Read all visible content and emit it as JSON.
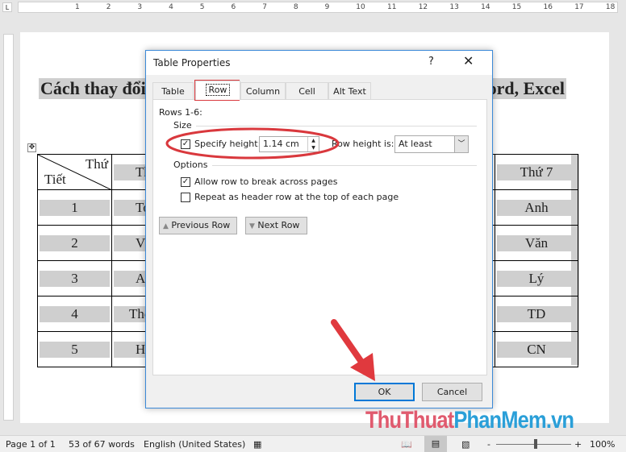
{
  "ruler": {
    "corner": "L",
    "ticks": [
      "1",
      "2",
      "3",
      "4",
      "5",
      "6",
      "7",
      "8",
      "9",
      "10",
      "11",
      "12",
      "13",
      "14",
      "15",
      "16",
      "17",
      "18"
    ]
  },
  "document": {
    "heading_left": "Cách thay đổi",
    "heading_right": "ord, Excel",
    "table": {
      "header": {
        "diag_top": "Thứ",
        "diag_bottom": "Tiết",
        "col2": "Th",
        "last": "Thứ 7"
      },
      "rows": [
        {
          "num": "1",
          "col2": "To",
          "last": "Anh"
        },
        {
          "num": "2",
          "col2": "V",
          "last": "Văn"
        },
        {
          "num": "3",
          "col2": "A",
          "last": "Lý"
        },
        {
          "num": "4",
          "col2": "Thể",
          "last": "TD"
        },
        {
          "num": "5",
          "col2": "H",
          "last": "CN"
        }
      ]
    }
  },
  "dialog": {
    "title": "Table Properties",
    "help": "?",
    "close": "✕",
    "tabs": [
      "Table",
      "Row",
      "Column",
      "Cell",
      "Alt Text"
    ],
    "active_tab": "Row",
    "rows_label": "Rows 1-6:",
    "size_label": "Size",
    "specify_height_label": "Specify height:",
    "specify_height_checked": true,
    "height_value": "1.14 cm",
    "row_height_is_label": "Row height is:",
    "row_height_is_value": "At least",
    "options_label": "Options",
    "allow_break_label": "Allow row to break across pages",
    "allow_break_checked": true,
    "repeat_header_label": "Repeat as header row at the top of each page",
    "repeat_header_checked": false,
    "previous_row": "Previous Row",
    "next_row": "Next Row",
    "ok": "OK",
    "cancel": "Cancel"
  },
  "status_bar": {
    "page": "Page 1 of 1",
    "words": "53 of 67 words",
    "language": "English (United States)",
    "zoom": "100%",
    "zoom_minus": "-",
    "zoom_plus": "+"
  },
  "watermark": {
    "part1": "ThuThuat",
    "part2": "PhanMem.vn",
    "color1": "#e05a6e",
    "color2": "#2a9fd8"
  },
  "annotation_color": "#e0393e"
}
